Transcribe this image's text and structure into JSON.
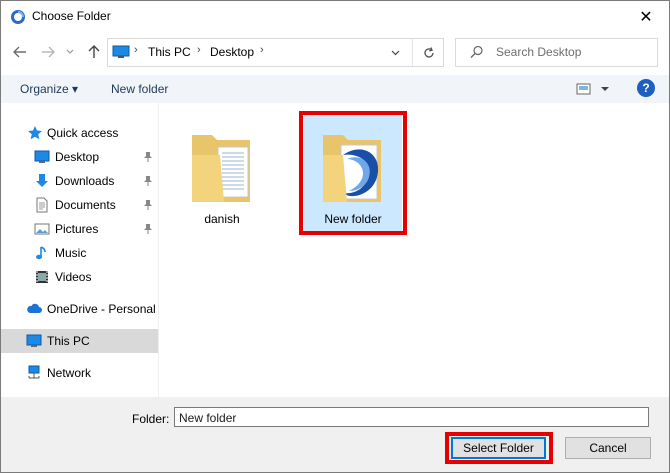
{
  "window": {
    "title": "Choose Folder"
  },
  "address": {
    "crumbs": [
      "This PC",
      "Desktop"
    ],
    "search_placeholder": "Search Desktop"
  },
  "commands": {
    "organize": "Organize ▾",
    "new_folder": "New folder"
  },
  "nav": {
    "items": [
      {
        "label": "Quick access",
        "icon": "star-icon"
      },
      {
        "label": "Desktop",
        "icon": "desktop-icon",
        "pinned": true
      },
      {
        "label": "Downloads",
        "icon": "download-icon",
        "pinned": true
      },
      {
        "label": "Documents",
        "icon": "document-icon",
        "pinned": true
      },
      {
        "label": "Pictures",
        "icon": "pictures-icon",
        "pinned": true
      },
      {
        "label": "Music",
        "icon": "music-icon"
      },
      {
        "label": "Videos",
        "icon": "video-icon"
      },
      {
        "label": "OneDrive - Personal",
        "icon": "cloud-icon"
      },
      {
        "label": "This PC",
        "icon": "computer-icon",
        "selected": true
      },
      {
        "label": "Network",
        "icon": "network-icon"
      }
    ]
  },
  "content": {
    "items": [
      {
        "label": "danish",
        "icon": "folder-icon"
      },
      {
        "label": "New folder",
        "icon": "folder-icon",
        "selected": true
      }
    ]
  },
  "footer": {
    "folder_label": "Folder:",
    "folder_value": "New folder",
    "select_button": "Select Folder",
    "cancel_button": "Cancel"
  },
  "colors": {
    "accent": "#0078d7",
    "highlight": "#e60000",
    "selection": "#cce8ff"
  }
}
